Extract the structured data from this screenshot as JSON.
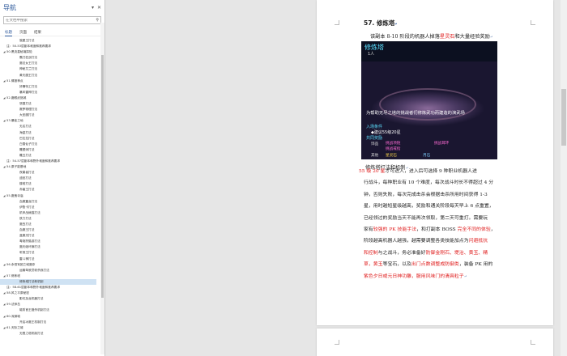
{
  "nav": {
    "title": "导航",
    "search_placeholder": "在文档中搜索",
    "tabs": [
      "标题",
      "页面",
      "结果"
    ],
    "items": [
      {
        "text": "饿屋王打法",
        "level": 2,
        "tri": ""
      },
      {
        "text": "注：50-53层副本难度和推荐要求",
        "level": 1,
        "tri": ""
      },
      {
        "text": "50.黑流星秘境探险",
        "level": 1,
        "tri": "◢"
      },
      {
        "text": "霸刀狂战打法",
        "level": 2,
        "tri": ""
      },
      {
        "text": "魔法女王打法",
        "level": 2,
        "tri": ""
      },
      {
        "text": "神秘艾兰打法",
        "level": 2,
        "tri": ""
      },
      {
        "text": "黄天魔王打法",
        "level": 2,
        "tri": ""
      },
      {
        "text": "51.情报神点",
        "level": 1,
        "tri": "◢"
      },
      {
        "text": "奸猾特工打法",
        "level": 2,
        "tri": ""
      },
      {
        "text": "暴风雷神打法",
        "level": 2,
        "tri": ""
      },
      {
        "text": "52.魔眼武馆城",
        "level": 1,
        "tri": "◢"
      },
      {
        "text": "怒猿打法",
        "level": 2,
        "tri": ""
      },
      {
        "text": "赛罗物理打法",
        "level": 2,
        "tri": ""
      },
      {
        "text": "大圣魔打法",
        "level": 2,
        "tri": ""
      },
      {
        "text": "53.暴徒之地",
        "level": 1,
        "tri": "◢"
      },
      {
        "text": "无名打法",
        "level": 2,
        "tri": ""
      },
      {
        "text": "海盗打法",
        "level": 2,
        "tri": ""
      },
      {
        "text": "巴拉拉打法",
        "level": 2,
        "tri": ""
      },
      {
        "text": "白雪仙子打法",
        "level": 2,
        "tri": ""
      },
      {
        "text": "雕塑师打法",
        "level": 2,
        "tri": ""
      },
      {
        "text": "雕丑打法",
        "level": 2,
        "tri": ""
      },
      {
        "text": "注：54-57层副本和野外难度和推荐要求",
        "level": 1,
        "tri": ""
      },
      {
        "text": "54.原子能基地",
        "level": 1,
        "tri": "◢"
      },
      {
        "text": "夜巢者打法",
        "level": 2,
        "tri": ""
      },
      {
        "text": "迪芭打法",
        "level": 2,
        "tri": ""
      },
      {
        "text": "楼塔打法",
        "level": 2,
        "tri": ""
      },
      {
        "text": "赤菌王打法",
        "level": 2,
        "tri": ""
      },
      {
        "text": "55.魔鬼寺庙",
        "level": 1,
        "tri": "◢"
      },
      {
        "text": "血魔翼龙打法",
        "level": 2,
        "tri": ""
      },
      {
        "text": "伊鲁卡打法",
        "level": 2,
        "tri": ""
      },
      {
        "text": "机甲战熊猫打法",
        "level": 2,
        "tri": ""
      },
      {
        "text": "铁力打法",
        "level": 2,
        "tri": ""
      },
      {
        "text": "魔虫打法",
        "level": 2,
        "tri": ""
      },
      {
        "text": "血魔王打法",
        "level": 2,
        "tri": ""
      },
      {
        "text": "蓝魔灵打法",
        "level": 2,
        "tri": ""
      },
      {
        "text": "粤炮狩猫游打法",
        "level": 2,
        "tri": ""
      },
      {
        "text": "魔天破坏狮打法",
        "level": 2,
        "tri": ""
      },
      {
        "text": "听莲王打法",
        "level": 2,
        "tri": ""
      },
      {
        "text": "雷斗神打法",
        "level": 2,
        "tri": ""
      },
      {
        "text": "56.永恒军团之域魔命",
        "level": 1,
        "tri": "◢"
      },
      {
        "text": "运输驾驶员斩杀我打法",
        "level": 2,
        "tri": ""
      },
      {
        "text": "57.修炼塔",
        "level": 1,
        "tri": "◢"
      },
      {
        "text": "修炼塔打法和机制",
        "level": 2,
        "tri": "",
        "sel": true
      },
      {
        "text": "注：58-61层副本和野外难度和推荐要求",
        "level": 1,
        "tri": ""
      },
      {
        "text": "58.风之平原秘密",
        "level": 1,
        "tri": "◢"
      },
      {
        "text": "影虹加龙机器打法",
        "level": 2,
        "tri": ""
      },
      {
        "text": "59.法师岛",
        "level": 1,
        "tri": "◢"
      },
      {
        "text": "磁秀首王猎杀机制打法",
        "level": 2,
        "tri": ""
      },
      {
        "text": "60.深渊城",
        "level": 1,
        "tri": "◢"
      },
      {
        "text": "开启冰魔王机制打法",
        "level": 2,
        "tri": ""
      },
      {
        "text": "61.天际之城",
        "level": 1,
        "tri": "◢"
      },
      {
        "text": "无限之塔机制打法",
        "level": 2,
        "tri": ""
      }
    ]
  },
  "doc": {
    "heading": "57. 修炼塔",
    "intro_pre": "该副本 8-10 阶段的机器人掉落",
    "intro_red": "星灵石",
    "intro_post": "和大量经验奖励",
    "caption": "修炼塔打法和机制",
    "shot": {
      "title": "修炼塔",
      "sub": "1人",
      "desc": "为帮助无尽之塔的挑战者们修炼武功而建造的演武场",
      "cond_h": "入场条件",
      "cond": "◆建议55级20星",
      "rew_h": "共同奖励",
      "r1": "挑战项链",
      "r2": "挑战耳环",
      "r3": "挑战戒指",
      "r4": "星灵石",
      "r5": "月石",
      "label_item": "饰品",
      "label_other": "其他"
    },
    "lines": [
      [
        {
          "t": "55 级 20 星",
          "r": true
        },
        {
          "t": "才可进入，进入后可选择 9 种职业机器人进"
        }
      ],
      [
        {
          "t": "行战斗，每种职业有 10 个难度，每次战斗时长不得超过 4 分"
        }
      ],
      [
        {
          "t": "钟，否则失败，每次完成击杀会根据击杀所用时间获得 1-3"
        }
      ],
      [
        {
          "t": "星，用时越短星级越高，奖励和通关阶段每天早上 6 点重置，"
        }
      ],
      [
        {
          "t": "已经领过的奖励当天不能再次领取，第二天可重打。需要玩"
        }
      ],
      [
        {
          "t": "家有"
        },
        {
          "t": "较强的 PK 技能手法",
          "r": true
        },
        {
          "t": "，和打副本 BOSS "
        },
        {
          "t": "完全不同的体验",
          "r": true
        },
        {
          "t": "，"
        }
      ],
      [
        {
          "t": "阶段越高机器人越强，越需要调整各类技能加点为"
        },
        {
          "t": "闪避抵抗",
          "r": true
        }
      ],
      [
        {
          "t": "和控制",
          "r": true
        },
        {
          "t": "与之战斗，务必准备好"
        },
        {
          "t": "防御金刚石、堤治、黄玉、精",
          "r": true
        }
      ],
      [
        {
          "t": "草，黄玉",
          "r": true
        },
        {
          "t": "等宝石，以及"
        },
        {
          "t": "出门点数调整成防御类",
          "r": true
        },
        {
          "t": "，装备 PK 用的"
        }
      ],
      [
        {
          "t": "紫色夕日或元日神功雕，服用风味门的清爽粒子",
          "r": true
        }
      ]
    ]
  }
}
